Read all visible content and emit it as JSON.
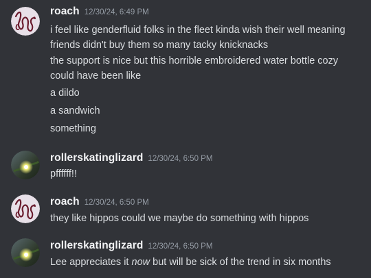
{
  "users": {
    "roach": {
      "name": "roach",
      "avatar_icon": "snake-doodle-avatar-icon",
      "avatar_bg": "#e8e0e8",
      "avatar_ink": "#6a1c2e"
    },
    "lizard": {
      "name": "rollerskatinglizard",
      "avatar_icon": "glowing-lizard-avatar-icon",
      "avatar_bg": "#2f3a2c",
      "avatar_glow": "#f2f07a"
    }
  },
  "messages": [
    {
      "author": "roach",
      "timestamp": "12/30/24, 6:49 PM",
      "lines": [
        "i feel like genderfluid folks in the fleet kinda wish their well meaning",
        "friends didn't buy them so many tacky knicknacks",
        "the support is nice but this horrible embroidered water bottle cozy",
        "could have been like",
        "a dildo",
        "a sandwich",
        "something"
      ]
    },
    {
      "author": "rollerskatinglizard",
      "timestamp": "12/30/24, 6:50 PM",
      "lines": [
        "pffffff!!"
      ]
    },
    {
      "author": "roach",
      "timestamp": "12/30/24, 6:50 PM",
      "lines": [
        "they like hippos could we maybe do something with hippos"
      ]
    },
    {
      "author": "rollerskatinglizard",
      "timestamp": "12/30/24, 6:50 PM",
      "lines": [
        {
          "before": "Lee appreciates it ",
          "emph": "now",
          "after": " but will be sick of the trend in six months"
        }
      ]
    }
  ]
}
